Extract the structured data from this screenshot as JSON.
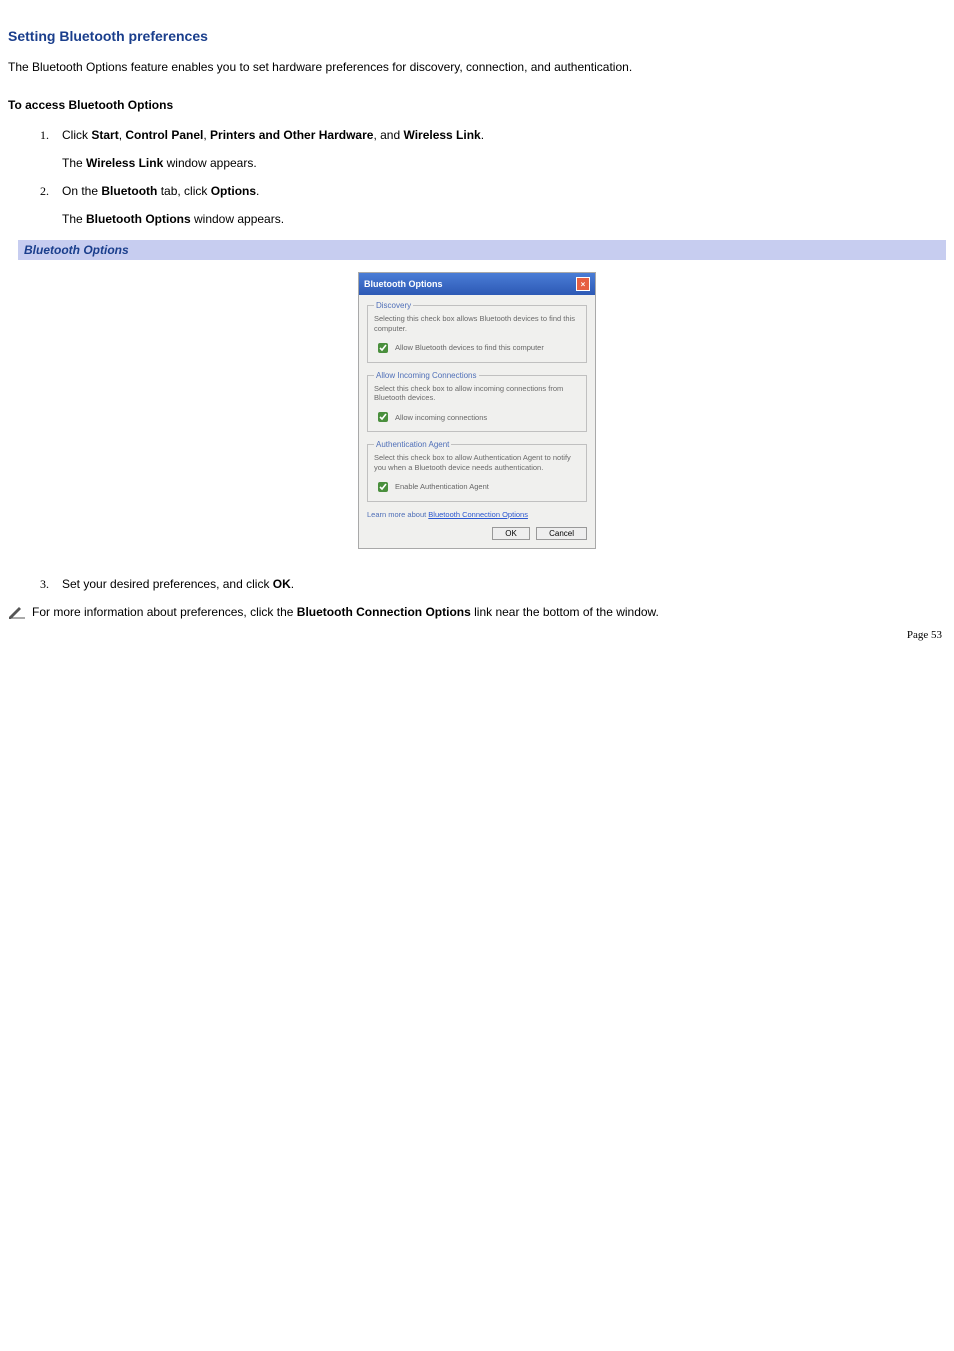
{
  "heading": "Setting Bluetooth preferences",
  "intro": "The Bluetooth Options feature enables you to set hardware preferences for discovery, connection, and authentication.",
  "subheading": "To access Bluetooth Options",
  "steps": {
    "s1_marker": "1.",
    "s1a_text_a": "Click ",
    "s1a_b1": "Start",
    "s1a_comma1": ", ",
    "s1a_b2": "Control Panel",
    "s1a_comma2": ", ",
    "s1a_b3": "Printers and Other Hardware",
    "s1a_comma3": ", and ",
    "s1a_b4": "Wireless Link",
    "s1a_end": ".",
    "s1b_a": "The ",
    "s1b_b": "Wireless Link",
    "s1b_c": " window appears.",
    "s2_marker": "2.",
    "s2a_a": "On the ",
    "s2a_b": "Bluetooth",
    "s2a_c": " tab, click ",
    "s2a_d": "Options",
    "s2a_e": ".",
    "s2b_a": "The ",
    "s2b_b": "Bluetooth Options",
    "s2b_c": " window appears.",
    "s3_marker": "3.",
    "s3a_a": "Set your desired preferences, and click ",
    "s3a_b": "OK",
    "s3a_c": "."
  },
  "caption": "Bluetooth Options",
  "dialog": {
    "title": "Bluetooth Options",
    "close": "×",
    "discovery": {
      "legend": "Discovery",
      "desc": "Selecting this check box allows Bluetooth devices to find this computer.",
      "check": "Allow Bluetooth devices to find this computer"
    },
    "incoming": {
      "legend": "Allow Incoming Connections",
      "desc": "Select this check box to allow incoming connections from Bluetooth devices.",
      "check": "Allow incoming connections"
    },
    "auth": {
      "legend": "Authentication Agent",
      "desc": "Select this check box to allow Authentication Agent to notify you when a Bluetooth device needs authentication.",
      "check": "Enable Authentication Agent"
    },
    "learn_a": "Learn more about ",
    "learn_link": "Bluetooth Connection Options",
    "ok": "OK",
    "cancel": "Cancel"
  },
  "note_a": "For more information about preferences, click the ",
  "note_b": "Bluetooth Connection Options",
  "note_c": " link near the bottom of the window.",
  "page_label": "Page 53"
}
